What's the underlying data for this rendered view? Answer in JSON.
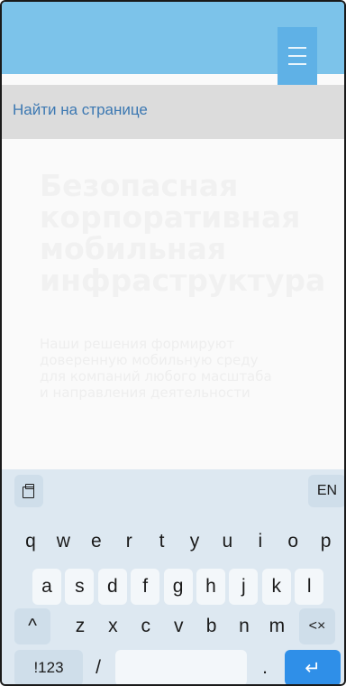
{
  "find_bar": {
    "label": "Найти на странице"
  },
  "hero": {
    "title": "Безопасная\nкорпоративная\nмобильная\nинфраструктура",
    "subtitle": "Наши решения формируют\nдоверенную мобильную среду\nдля компаний любого масштаба\nи направления деятельности"
  },
  "keyboard": {
    "language_label": "EN",
    "row1": [
      "q",
      "w",
      "e",
      "r",
      "t",
      "y",
      "u",
      "i",
      "o",
      "p"
    ],
    "row2": [
      "a",
      "s",
      "d",
      "f",
      "g",
      "h",
      "j",
      "k",
      "l"
    ],
    "row3": [
      "z",
      "x",
      "c",
      "v",
      "b",
      "n",
      "m"
    ],
    "shift_glyph": "^",
    "backspace_glyph": "<×",
    "symbols_label": "!123",
    "slash_label": "/",
    "period_label": ".",
    "enter_glyph": "↵"
  },
  "icons": {
    "menu": "hamburger-menu-icon",
    "clipboard": "clipboard-icon"
  },
  "colors": {
    "header": "#7cc3ea",
    "menu_button": "#5fb1e6",
    "find_label": "#3c78b2",
    "keyboard_bg": "#dde8f1",
    "enter_key": "#2f8fe8"
  }
}
